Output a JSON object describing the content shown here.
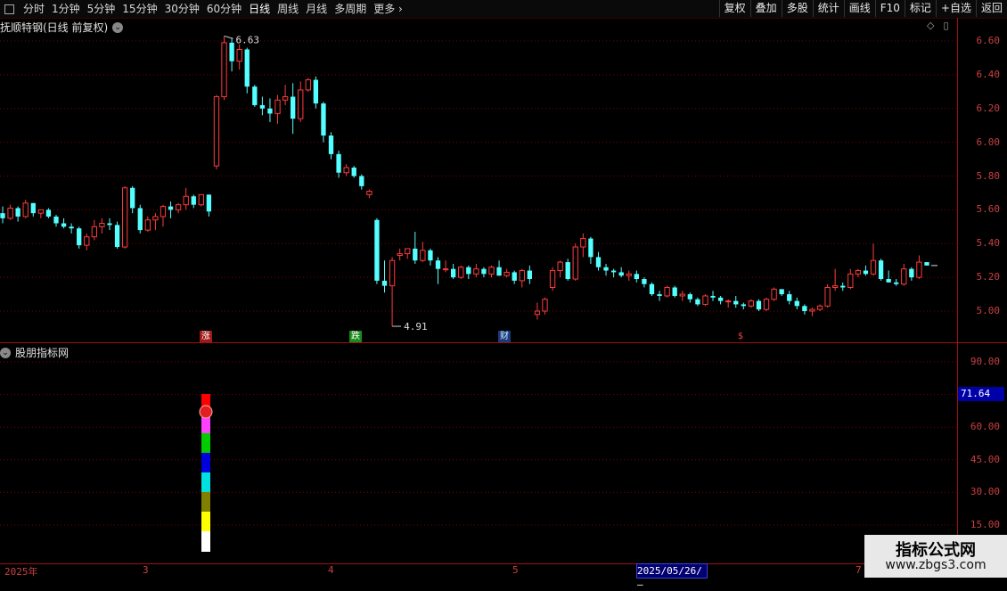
{
  "toolbar": {
    "periods": [
      "分时",
      "1分钟",
      "5分钟",
      "15分钟",
      "30分钟",
      "60分钟",
      "日线",
      "周线",
      "月线",
      "多周期",
      "更多"
    ],
    "active_period": "日线",
    "right_buttons": [
      "复权",
      "叠加",
      "多股",
      "统计",
      "画线",
      "F10",
      "标记",
      "+自选",
      "返回"
    ]
  },
  "main_pane": {
    "title": "抚顺特钢(日线 前复权)",
    "y_ticks": [
      "6.60",
      "6.40",
      "6.20",
      "6.00",
      "5.80",
      "5.60",
      "5.40",
      "5.20",
      "5.00"
    ],
    "high_label": "6.63",
    "low_label": "4.91",
    "tags": [
      {
        "text": "涨",
        "color": "#ffffff",
        "bg": "#a01818"
      },
      {
        "text": "跌",
        "color": "#ffffff",
        "bg": "#1a8a1a"
      },
      {
        "text": "财",
        "color": "#d0e8ff",
        "bg": "#1a3a7a"
      },
      {
        "text": "$",
        "color": "#ff4040",
        "bg": "transparent"
      }
    ]
  },
  "sub_pane": {
    "title": "股朋指标网",
    "y_ticks": [
      "90.00",
      "75.00",
      "60.00",
      "45.00",
      "30.00",
      "15.00"
    ],
    "current_value": "71.64"
  },
  "date_axis": {
    "labels": [
      "2025年",
      "3",
      "4",
      "5",
      "7"
    ],
    "cursor_date": "2025/05/26/—"
  },
  "watermark": {
    "name": "指标公式网",
    "url": "www.zbgs3.com"
  },
  "colors": {
    "up": "#ff3b3b",
    "down": "#54ffff",
    "grid": "#7a0000",
    "axis": "#c84040"
  },
  "chart_data": {
    "type": "candlestick",
    "ylim": [
      4.88,
      6.66
    ],
    "candles": [
      [
        5.58,
        5.62,
        5.52,
        5.55
      ],
      [
        5.55,
        5.63,
        5.54,
        5.61
      ],
      [
        5.61,
        5.62,
        5.53,
        5.56
      ],
      [
        5.56,
        5.66,
        5.55,
        5.64
      ],
      [
        5.64,
        5.64,
        5.56,
        5.58
      ],
      [
        5.58,
        5.6,
        5.55,
        5.6
      ],
      [
        5.6,
        5.61,
        5.55,
        5.56
      ],
      [
        5.56,
        5.57,
        5.5,
        5.52
      ],
      [
        5.52,
        5.55,
        5.49,
        5.5
      ],
      [
        5.5,
        5.52,
        5.46,
        5.49
      ],
      [
        5.49,
        5.5,
        5.37,
        5.39
      ],
      [
        5.39,
        5.46,
        5.36,
        5.44
      ],
      [
        5.44,
        5.54,
        5.42,
        5.5
      ],
      [
        5.5,
        5.55,
        5.46,
        5.52
      ],
      [
        5.52,
        5.55,
        5.48,
        5.51
      ],
      [
        5.51,
        5.53,
        5.37,
        5.38
      ],
      [
        5.38,
        5.74,
        5.37,
        5.73
      ],
      [
        5.73,
        5.74,
        5.58,
        5.61
      ],
      [
        5.61,
        5.63,
        5.46,
        5.48
      ],
      [
        5.48,
        5.56,
        5.47,
        5.54
      ],
      [
        5.54,
        5.58,
        5.48,
        5.56
      ],
      [
        5.56,
        5.63,
        5.5,
        5.62
      ],
      [
        5.62,
        5.65,
        5.55,
        5.6
      ],
      [
        5.6,
        5.64,
        5.58,
        5.63
      ],
      [
        5.63,
        5.73,
        5.6,
        5.68
      ],
      [
        5.68,
        5.69,
        5.61,
        5.63
      ],
      [
        5.63,
        5.69,
        5.62,
        5.69
      ],
      [
        5.69,
        5.69,
        5.56,
        5.59
      ],
      [
        5.86,
        6.28,
        5.84,
        6.27
      ],
      [
        6.27,
        6.63,
        6.25,
        6.59
      ],
      [
        6.59,
        6.62,
        6.42,
        6.48
      ],
      [
        6.48,
        6.58,
        6.43,
        6.55
      ],
      [
        6.55,
        6.56,
        6.29,
        6.33
      ],
      [
        6.33,
        6.34,
        6.21,
        6.22
      ],
      [
        6.22,
        6.27,
        6.16,
        6.2
      ],
      [
        6.2,
        6.26,
        6.12,
        6.17
      ],
      [
        6.17,
        6.28,
        6.11,
        6.25
      ],
      [
        6.25,
        6.34,
        6.22,
        6.27
      ],
      [
        6.27,
        6.35,
        6.05,
        6.14
      ],
      [
        6.14,
        6.36,
        6.12,
        6.31
      ],
      [
        6.31,
        6.38,
        6.3,
        6.37
      ],
      [
        6.37,
        6.39,
        6.2,
        6.23
      ],
      [
        6.23,
        6.24,
        6.0,
        6.04
      ],
      [
        6.04,
        6.06,
        5.9,
        5.93
      ],
      [
        5.93,
        5.95,
        5.79,
        5.82
      ],
      [
        5.82,
        5.87,
        5.8,
        5.85
      ],
      [
        5.85,
        5.86,
        5.79,
        5.8
      ],
      [
        5.8,
        5.81,
        5.72,
        5.74
      ],
      [
        5.69,
        5.72,
        5.67,
        5.71
      ],
      [
        5.54,
        5.55,
        5.16,
        5.18
      ],
      [
        5.18,
        5.3,
        5.11,
        5.15
      ],
      [
        5.15,
        5.32,
        4.91,
        5.3
      ],
      [
        5.33,
        5.37,
        5.3,
        5.34
      ],
      [
        5.34,
        5.37,
        5.31,
        5.37
      ],
      [
        5.37,
        5.47,
        5.28,
        5.3
      ],
      [
        5.3,
        5.41,
        5.29,
        5.36
      ],
      [
        5.36,
        5.37,
        5.27,
        5.3
      ],
      [
        5.3,
        5.32,
        5.16,
        5.25
      ],
      [
        5.25,
        5.3,
        5.23,
        5.25
      ],
      [
        5.25,
        5.28,
        5.19,
        5.2
      ],
      [
        5.2,
        5.27,
        5.19,
        5.26
      ],
      [
        5.26,
        5.27,
        5.19,
        5.22
      ],
      [
        5.22,
        5.28,
        5.2,
        5.25
      ],
      [
        5.25,
        5.26,
        5.2,
        5.22
      ],
      [
        5.22,
        5.27,
        5.2,
        5.26
      ],
      [
        5.26,
        5.3,
        5.21,
        5.21
      ],
      [
        5.21,
        5.25,
        5.2,
        5.23
      ],
      [
        5.23,
        5.24,
        5.16,
        5.18
      ],
      [
        5.18,
        5.25,
        5.14,
        5.24
      ],
      [
        5.24,
        5.27,
        5.16,
        5.19
      ],
      [
        4.98,
        5.05,
        4.95,
        5.0
      ],
      [
        5.0,
        5.08,
        4.98,
        5.07
      ],
      [
        5.14,
        5.26,
        5.12,
        5.24
      ],
      [
        5.24,
        5.3,
        5.2,
        5.29
      ],
      [
        5.29,
        5.31,
        5.18,
        5.19
      ],
      [
        5.19,
        5.4,
        5.18,
        5.38
      ],
      [
        5.38,
        5.46,
        5.32,
        5.43
      ],
      [
        5.43,
        5.44,
        5.28,
        5.32
      ],
      [
        5.32,
        5.35,
        5.24,
        5.26
      ],
      [
        5.26,
        5.28,
        5.21,
        5.24
      ],
      [
        5.24,
        5.25,
        5.2,
        5.23
      ],
      [
        5.23,
        5.26,
        5.2,
        5.21
      ],
      [
        5.21,
        5.24,
        5.18,
        5.22
      ],
      [
        5.22,
        5.24,
        5.17,
        5.19
      ],
      [
        5.19,
        5.2,
        5.14,
        5.16
      ],
      [
        5.16,
        5.17,
        5.09,
        5.1
      ],
      [
        5.1,
        5.12,
        5.06,
        5.09
      ],
      [
        5.09,
        5.15,
        5.08,
        5.14
      ],
      [
        5.14,
        5.15,
        5.08,
        5.09
      ],
      [
        5.09,
        5.12,
        5.06,
        5.1
      ],
      [
        5.1,
        5.11,
        5.05,
        5.07
      ],
      [
        5.07,
        5.08,
        5.03,
        5.04
      ],
      [
        5.04,
        5.1,
        5.03,
        5.09
      ],
      [
        5.09,
        5.12,
        5.06,
        5.08
      ],
      [
        5.08,
        5.09,
        5.04,
        5.06
      ],
      [
        5.06,
        5.07,
        5.02,
        5.06
      ],
      [
        5.06,
        5.09,
        5.02,
        5.04
      ],
      [
        5.04,
        5.05,
        5.01,
        5.03
      ],
      [
        5.03,
        5.07,
        5.02,
        5.06
      ],
      [
        5.06,
        5.07,
        5.0,
        5.01
      ],
      [
        5.01,
        5.08,
        5.0,
        5.07
      ],
      [
        5.07,
        5.14,
        5.06,
        5.13
      ],
      [
        5.13,
        5.13,
        5.09,
        5.1
      ],
      [
        5.1,
        5.12,
        5.04,
        5.06
      ],
      [
        5.06,
        5.08,
        5.01,
        5.03
      ],
      [
        5.03,
        5.04,
        4.98,
        5.0
      ],
      [
        5.0,
        5.02,
        4.97,
        5.01
      ],
      [
        5.01,
        5.04,
        5.0,
        5.03
      ],
      [
        5.03,
        5.16,
        5.02,
        5.14
      ],
      [
        5.14,
        5.25,
        5.12,
        5.15
      ],
      [
        5.15,
        5.17,
        5.12,
        5.14
      ],
      [
        5.14,
        5.25,
        5.13,
        5.22
      ],
      [
        5.22,
        5.25,
        5.2,
        5.24
      ],
      [
        5.24,
        5.27,
        5.21,
        5.22
      ],
      [
        5.22,
        5.4,
        5.21,
        5.3
      ],
      [
        5.3,
        5.31,
        5.18,
        5.19
      ],
      [
        5.19,
        5.24,
        5.17,
        5.17
      ],
      [
        5.17,
        5.19,
        5.15,
        5.16
      ],
      [
        5.16,
        5.28,
        5.15,
        5.25
      ],
      [
        5.25,
        5.26,
        5.18,
        5.2
      ],
      [
        5.2,
        5.33,
        5.19,
        5.29
      ],
      [
        5.29,
        5.29,
        5.27,
        5.27
      ]
    ],
    "indicator": {
      "value": 71.64,
      "ylim": [
        8,
        100
      ]
    }
  }
}
